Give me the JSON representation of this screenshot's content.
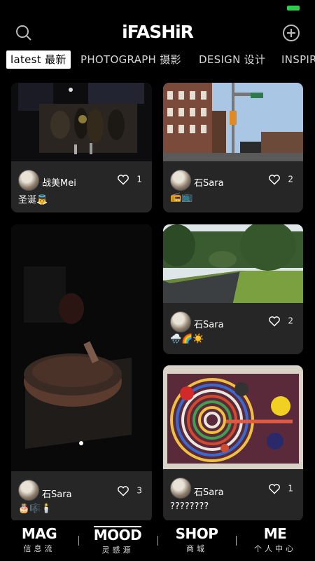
{
  "header": {
    "logo": "iFASHiR",
    "search_icon": "search-icon",
    "add_icon": "plus-circle-icon"
  },
  "tabs": [
    {
      "label": "latest 最新"
    },
    {
      "label": "PHOTOGRAPH 摄影"
    },
    {
      "label": "DESIGN 设计"
    },
    {
      "label": "INSPIR"
    }
  ],
  "cards": [
    {
      "user": "战美Mei",
      "likes": "1",
      "caption": "圣诞👼"
    },
    {
      "user": "石Sara",
      "likes": "2",
      "caption": "📻📺"
    },
    {
      "user": "石Sara",
      "likes": "3",
      "caption": "🎂🎼🕯️"
    },
    {
      "user": "石Sara",
      "likes": "2",
      "caption": "🌧️🌈☀️"
    },
    {
      "user": "石Sara",
      "likes": "1",
      "caption": "????????"
    }
  ],
  "nav": [
    {
      "title": "MAG",
      "sub": "信息流"
    },
    {
      "title": "MOOD",
      "sub": "灵感源"
    },
    {
      "title": "SHOP",
      "sub": "商城"
    },
    {
      "title": "ME",
      "sub": "个人中心"
    }
  ],
  "colors": {
    "background": "#000000",
    "card": "#262626",
    "battery": "#2ecc4f"
  }
}
